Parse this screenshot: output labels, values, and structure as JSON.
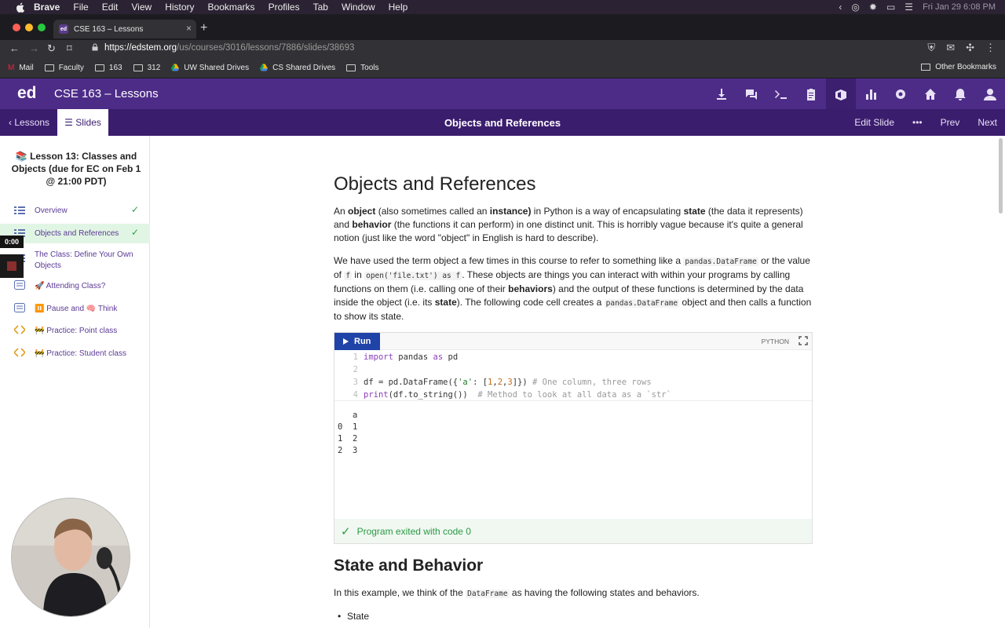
{
  "menubar": {
    "app": "Brave",
    "items": [
      "File",
      "Edit",
      "View",
      "History",
      "Bookmarks",
      "Profiles",
      "Tab",
      "Window",
      "Help"
    ],
    "clock": "Fri Jan 29  6:08 PM"
  },
  "browser": {
    "tab_title": "CSE 163 – Lessons",
    "url_host": "https://edstem.org",
    "url_path": "/us/courses/3016/lessons/7886/slides/38693",
    "bookmarks": [
      {
        "label": "Mail",
        "icon": "mail-icon"
      },
      {
        "label": "Faculty",
        "icon": "folder-icon"
      },
      {
        "label": "163",
        "icon": "folder-icon"
      },
      {
        "label": "312",
        "icon": "folder-icon"
      },
      {
        "label": "UW Shared Drives",
        "icon": "drive-icon"
      },
      {
        "label": "CS Shared Drives",
        "icon": "drive-icon"
      },
      {
        "label": "Tools",
        "icon": "folder-icon"
      }
    ],
    "other_bookmarks": "Other Bookmarks"
  },
  "ed": {
    "logo": "ed",
    "course_title": "CSE 163 – Lessons",
    "lessons_label": "Lessons",
    "slides_label": "Slides",
    "slide_title": "Objects and References",
    "edit_slide": "Edit Slide",
    "more": "•••",
    "prev": "Prev",
    "next": "Next"
  },
  "sidebar": {
    "lesson_title": "📚 Lesson 13: Classes and Objects (due for EC on Feb 1 @ 21:00 PDT)",
    "items": [
      {
        "label": "Overview",
        "done": "✓"
      },
      {
        "label": "Objects and References",
        "done": "✓"
      },
      {
        "label": "The Class: Define Your Own Objects",
        "done": ""
      },
      {
        "label": "🚀 Attending Class?",
        "done": ""
      },
      {
        "label": "⏸️ Pause and 🧠 Think",
        "done": ""
      },
      {
        "label": "🚧 Practice: Point class",
        "done": ""
      },
      {
        "label": "🚧 Practice: Student class",
        "done": ""
      }
    ],
    "timer": "0:00"
  },
  "content": {
    "title": "Objects and References",
    "p1_a": "An ",
    "p1_object": "object",
    "p1_b": " (also sometimes called an ",
    "p1_instance": "instance)",
    "p1_c": " in Python is a way of encapsulating ",
    "p1_state": "state",
    "p1_d": " (the data it represents) and ",
    "p1_behavior": "behavior",
    "p1_e": " (the functions it can perform) in one distinct unit. This is horribly vague because it's quite a general notion (just like the word \"object\" in English is hard to describe).",
    "p2_a": "We have used the term object a few times in this course to refer to something like a ",
    "p2_code1": "pandas.DataFrame",
    "p2_b": "  or the value of ",
    "p2_code2": "f",
    "p2_c": " in ",
    "p2_code3": "open('file.txt') as f",
    "p2_d": ". These objects are things you can interact with within your programs by calling functions on them (i.e. calling one of their ",
    "p2_behaviors": "behaviors",
    "p2_e": ") and the output of these functions is determined by the data inside the object (i.e. its ",
    "p2_state": "state",
    "p2_f": "). The following code cell creates a ",
    "p2_code4": "pandas.DataFrame",
    "p2_g": " object and then calls a function to show its state.",
    "run_label": "Run",
    "language": "PYTHON",
    "code_lines": [
      "1",
      "2",
      "3",
      "4"
    ],
    "output_lines": [
      "   a",
      "0  1",
      "1  2",
      "2  3"
    ],
    "exit_message": "Program exited with code 0",
    "h2": "State and Behavior",
    "p3_a": "In this example, we think of the ",
    "p3_code": "DataFrame",
    "p3_b": " as having the following states and behaviors.",
    "bullet1": "State"
  },
  "colors": {
    "ed_purple": "#4d2c88",
    "ed_purple_dark": "#3b1d6e",
    "run_blue": "#2043a8",
    "success_green": "#2a9a43"
  }
}
